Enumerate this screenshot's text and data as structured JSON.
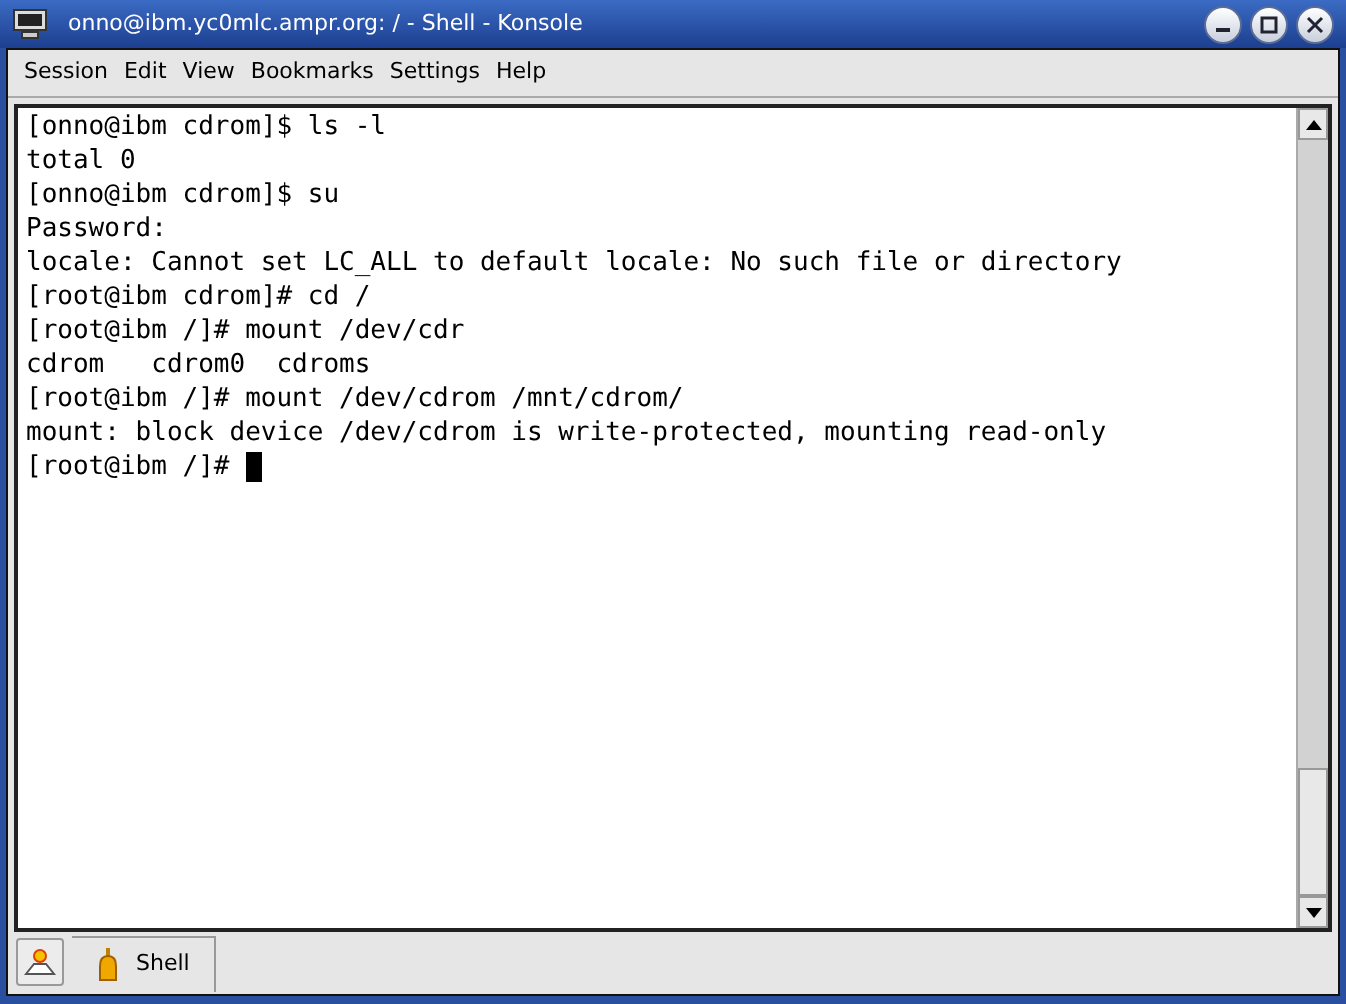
{
  "window": {
    "title": "onno@ibm.yc0mlc.ampr.org: / - Shell - Konsole"
  },
  "menu": [
    "Session",
    "Edit",
    "View",
    "Bookmarks",
    "Settings",
    "Help"
  ],
  "terminal": {
    "lines": [
      "[onno@ibm cdrom]$ ls -l",
      "total 0",
      "[onno@ibm cdrom]$ su",
      "Password:",
      "locale: Cannot set LC_ALL to default locale: No such file or directory",
      "[root@ibm cdrom]# cd /",
      "[root@ibm /]# mount /dev/cdr",
      "cdrom   cdrom0  cdroms",
      "[root@ibm /]# mount /dev/cdrom /mnt/cdrom/",
      "mount: block device /dev/cdrom is write-protected, mounting read-only",
      "[root@ibm /]# "
    ]
  },
  "tabs": [
    {
      "label": "Shell",
      "selected": true
    }
  ]
}
